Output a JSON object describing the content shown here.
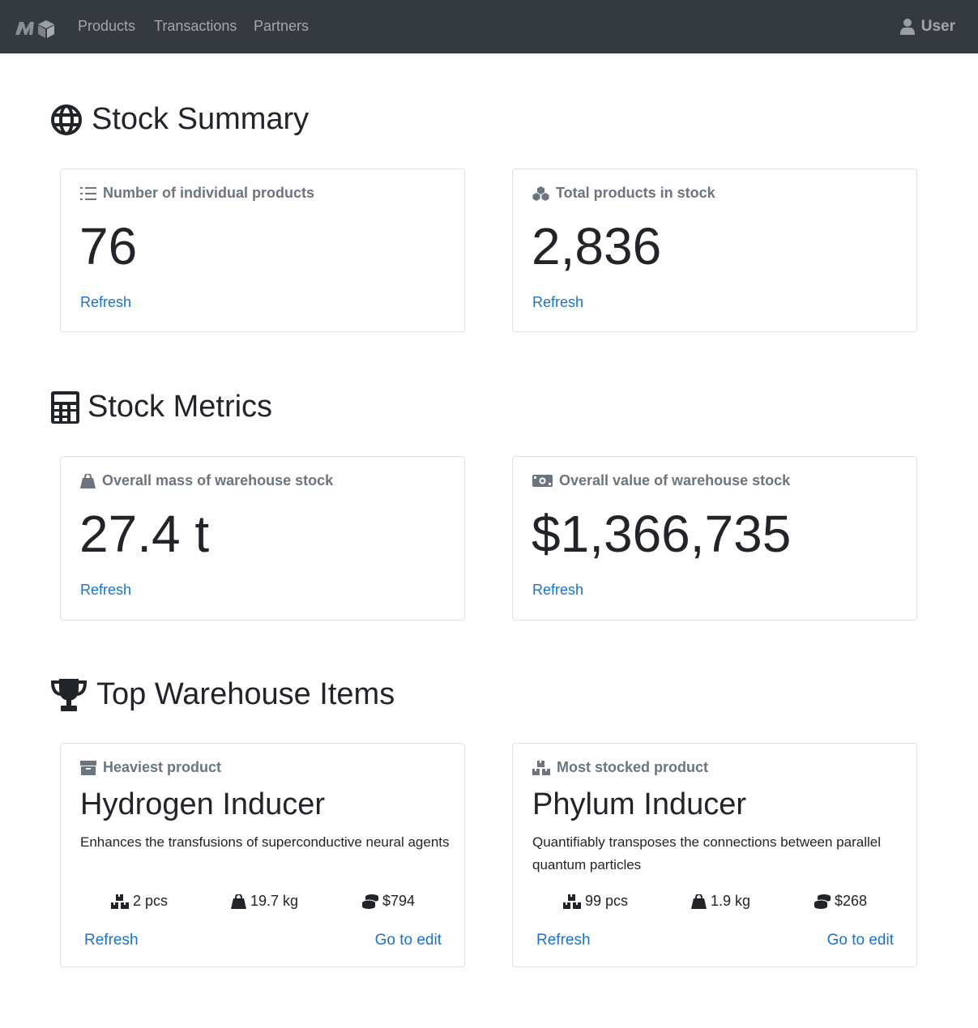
{
  "nav": {
    "brand": "M",
    "links": [
      "Products",
      "Transactions",
      "Partners"
    ],
    "user": "User"
  },
  "sections": {
    "summary_title": "Stock Summary",
    "metrics_title": "Stock Metrics",
    "top_title": "Top Warehouse Items"
  },
  "summary": {
    "products": {
      "label": "Number of individual products",
      "value": "76",
      "action": "Refresh"
    },
    "stock": {
      "label": "Total products in stock",
      "value": "2,836",
      "action": "Refresh"
    }
  },
  "metrics": {
    "mass": {
      "label": "Overall mass of warehouse stock",
      "value": "27.4 t",
      "action": "Refresh"
    },
    "value": {
      "label": "Overall value of warehouse stock",
      "value": "$1,366,735",
      "action": "Refresh"
    }
  },
  "top": {
    "heaviest": {
      "label": "Heaviest product",
      "name": "Hydrogen Inducer",
      "description": "Enhances the transfusions of superconductive neural agents",
      "qty": "2 pcs",
      "mass": "19.7 kg",
      "price": "$794",
      "refresh": "Refresh",
      "edit": "Go to edit"
    },
    "most_stocked": {
      "label": "Most stocked product",
      "name": "Phylum Inducer",
      "description": "Quantifiably transposes the connections between parallel quantum particles",
      "qty": "99 pcs",
      "mass": "1.9 kg",
      "price": "$268",
      "refresh": "Refresh",
      "edit": "Go to edit"
    }
  },
  "colors": {
    "navbar": "#343a40",
    "link": "#1a73c8",
    "muted": "#6c757d",
    "border": "#dee2e6"
  },
  "icons": [
    "logo-icon",
    "user-icon",
    "globe-icon",
    "list-icon",
    "cubes-icon",
    "calculator-icon",
    "weight-icon",
    "money-icon",
    "trophy-icon",
    "box-icon",
    "boxes-icon",
    "coins-icon"
  ]
}
